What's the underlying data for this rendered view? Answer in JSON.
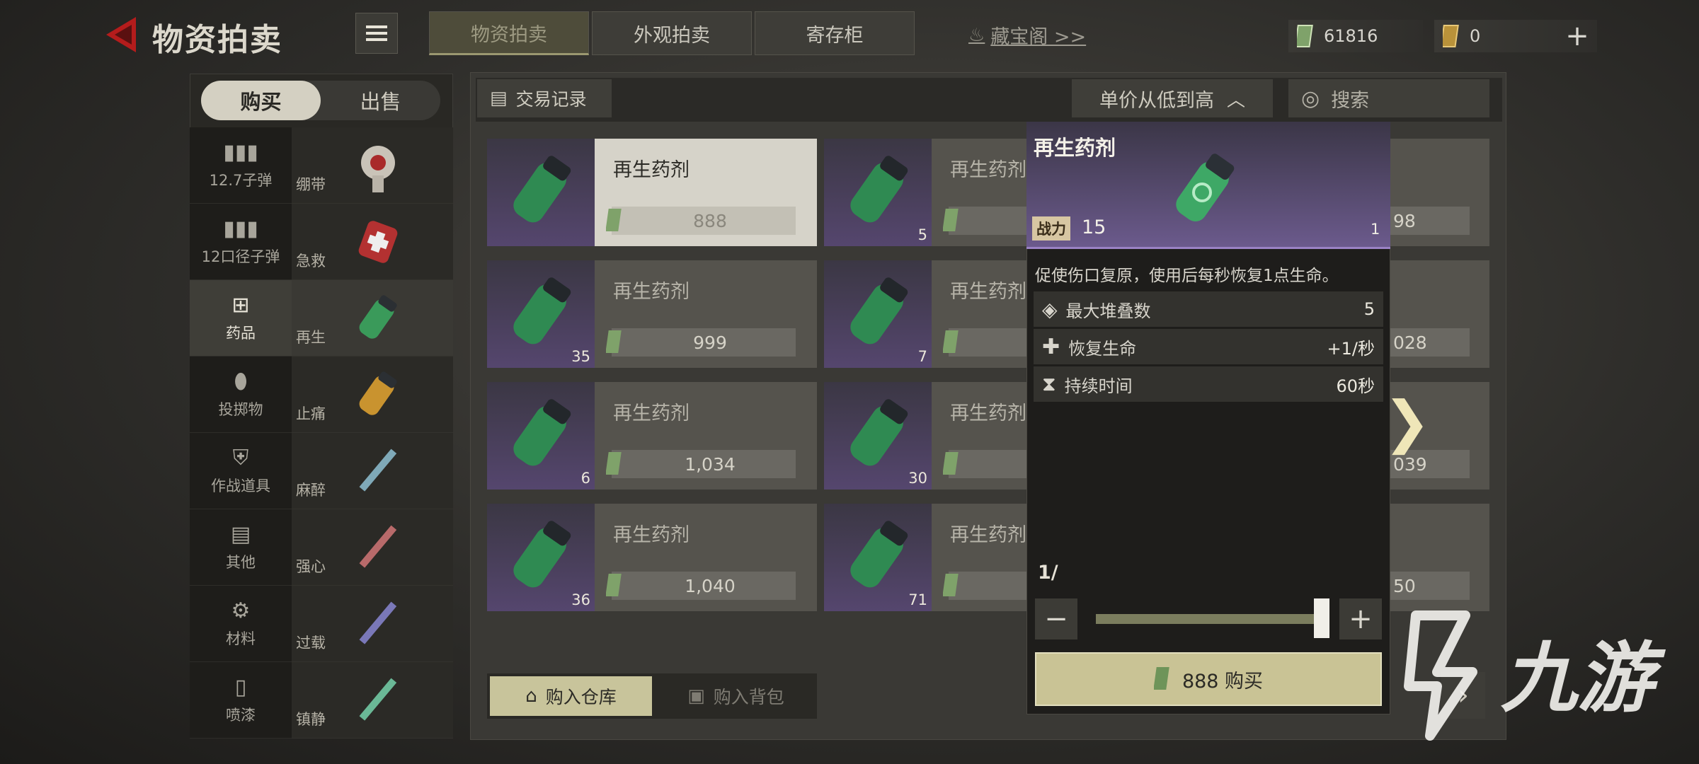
{
  "header": {
    "title": "物资拍卖",
    "tabs": [
      {
        "label": "物资拍卖",
        "active": true
      },
      {
        "label": "外观拍卖",
        "active": false
      },
      {
        "label": "寄存柜",
        "active": false
      }
    ],
    "treasure_link": "藏宝阁 >>",
    "currency_cash": "61816",
    "currency_gold": "0"
  },
  "sidebar": {
    "buy_label": "购买",
    "sell_label": "出售",
    "categories": [
      {
        "label": "12.7子弹",
        "icon": "ammo-icon"
      },
      {
        "label": "12口径子弹",
        "icon": "shells-icon"
      },
      {
        "label": "药品",
        "icon": "medkit-icon",
        "active": true
      },
      {
        "label": "投掷物",
        "icon": "grenade-icon"
      },
      {
        "label": "作战道具",
        "icon": "shield-icon"
      },
      {
        "label": "其他",
        "icon": "box-icon"
      },
      {
        "label": "材料",
        "icon": "gear-icon"
      },
      {
        "label": "喷漆",
        "icon": "spray-icon"
      }
    ],
    "subcategories": [
      {
        "label": "绷带",
        "icon": "bandage-icon"
      },
      {
        "label": "急救",
        "icon": "first-aid-icon"
      },
      {
        "label": "再生",
        "icon": "regen-icon",
        "active": true
      },
      {
        "label": "止痛",
        "icon": "painkiller-icon"
      },
      {
        "label": "麻醉",
        "icon": "syringe-icon"
      },
      {
        "label": "强心",
        "icon": "syringe-icon"
      },
      {
        "label": "过载",
        "icon": "syringe-icon"
      },
      {
        "label": "镇静",
        "icon": "syringe-icon"
      }
    ]
  },
  "toolbar": {
    "trade_log": "交易记录",
    "sort_label": "单价从低到高",
    "search_placeholder": "搜索"
  },
  "listings": {
    "col1": [
      {
        "name": "再生药剂",
        "price": "888",
        "qty": "",
        "selected": true
      },
      {
        "name": "再生药剂",
        "price": "999",
        "qty": "35"
      },
      {
        "name": "再生药剂",
        "price": "1,034",
        "qty": "6"
      },
      {
        "name": "再生药剂",
        "price": "1,040",
        "qty": "36"
      }
    ],
    "col2": [
      {
        "name": "再生药剂",
        "price": "",
        "qty": "5"
      },
      {
        "name": "再生药剂",
        "price": "",
        "qty": "7"
      },
      {
        "name": "再生药剂",
        "price": "",
        "qty": "30"
      },
      {
        "name": "再生药剂",
        "price": "",
        "qty": "71"
      }
    ],
    "col3_prices": [
      "98",
      "028",
      "039",
      "50"
    ]
  },
  "bottom": {
    "buy_to_warehouse": "购入仓库",
    "buy_to_backpack": "购入背包"
  },
  "detail": {
    "title": "再生药剂",
    "power_label": "战力",
    "power_value": "15",
    "count": "1",
    "description": "促使伤口复原，使用后每秒恢复1点生命。",
    "stats": [
      {
        "label": "最大堆叠数",
        "value": "5",
        "icon": "layers-icon"
      },
      {
        "label": "恢复生命",
        "value": "+1/秒",
        "icon": "heal-plus-icon"
      },
      {
        "label": "持续时间",
        "value": "60秒",
        "icon": "hourglass-icon"
      }
    ],
    "quantity_text": "1/",
    "quantity_fraction": 1.0,
    "buy_button": "888 购买"
  },
  "watermark": "九游"
}
